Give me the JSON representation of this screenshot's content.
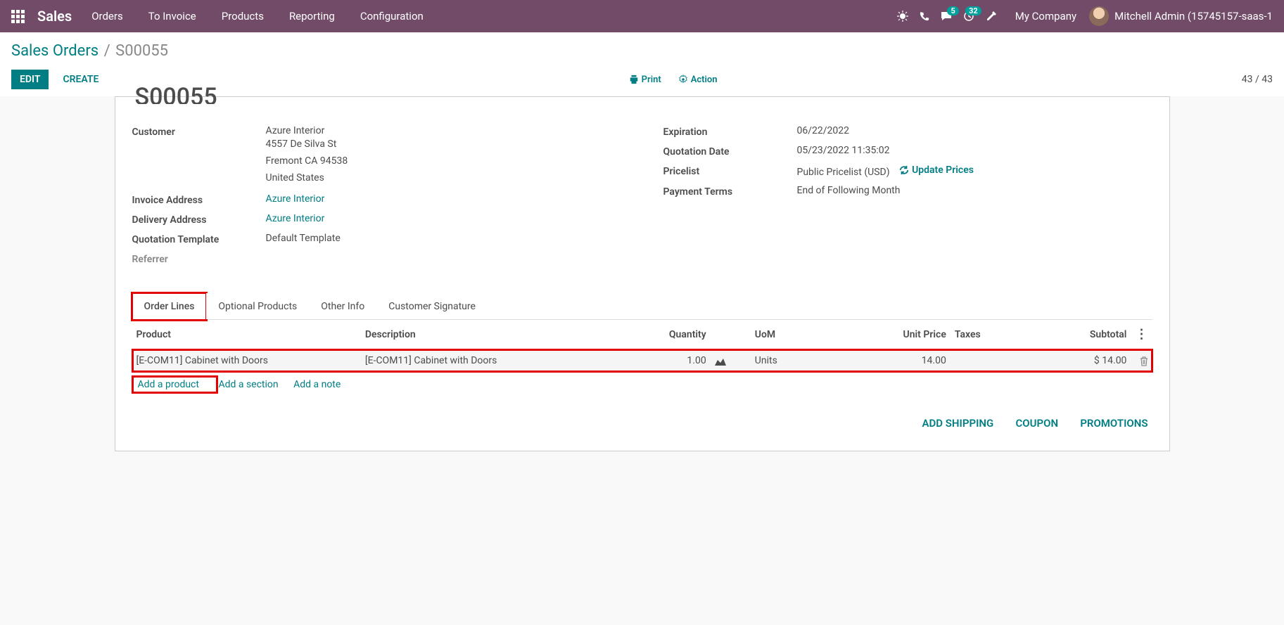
{
  "navbar": {
    "brand": "Sales",
    "items": [
      "Orders",
      "To Invoice",
      "Products",
      "Reporting",
      "Configuration"
    ],
    "messaging_badge": "5",
    "activities_badge": "32",
    "company": "My Company",
    "user": "Mitchell Admin (15745157-saas-1"
  },
  "breadcrumb": {
    "parent": "Sales Orders",
    "current": "S00055"
  },
  "buttons": {
    "edit": "EDIT",
    "create": "CREATE",
    "print": "Print",
    "action": "Action"
  },
  "pager": "43 / 43",
  "record": {
    "title": "S00055",
    "left": {
      "customer_label": "Customer",
      "customer_link": "Azure Interior",
      "customer_addr1": "4557 De Silva St",
      "customer_addr2": "Fremont CA 94538",
      "customer_addr3": "United States",
      "invoice_label": "Invoice Address",
      "invoice_value": "Azure Interior",
      "delivery_label": "Delivery Address",
      "delivery_value": "Azure Interior",
      "template_label": "Quotation Template",
      "template_value": "Default Template",
      "referrer_label": "Referrer"
    },
    "right": {
      "expiration_label": "Expiration",
      "expiration": "06/22/2022",
      "quote_date_label": "Quotation Date",
      "quote_date": "05/23/2022 11:35:02",
      "pricelist_label": "Pricelist",
      "pricelist": "Public Pricelist (USD)",
      "update_prices": "Update Prices",
      "payment_terms_label": "Payment Terms",
      "payment_terms": "End of Following Month"
    }
  },
  "tabs": [
    "Order Lines",
    "Optional Products",
    "Other Info",
    "Customer Signature"
  ],
  "columns": {
    "product": "Product",
    "description": "Description",
    "quantity": "Quantity",
    "uom": "UoM",
    "unit_price": "Unit Price",
    "taxes": "Taxes",
    "subtotal": "Subtotal"
  },
  "lines": [
    {
      "product": "[E-COM11] Cabinet with Doors",
      "description": "[E-COM11] Cabinet with Doors",
      "quantity": "1.00",
      "uom": "Units",
      "unit_price": "14.00",
      "taxes": "",
      "subtotal": "$ 14.00"
    }
  ],
  "add": {
    "product": "Add a product",
    "section": "Add a section",
    "note": "Add a note"
  },
  "footer": {
    "shipping": "ADD SHIPPING",
    "coupon": "COUPON",
    "promotions": "PROMOTIONS"
  }
}
